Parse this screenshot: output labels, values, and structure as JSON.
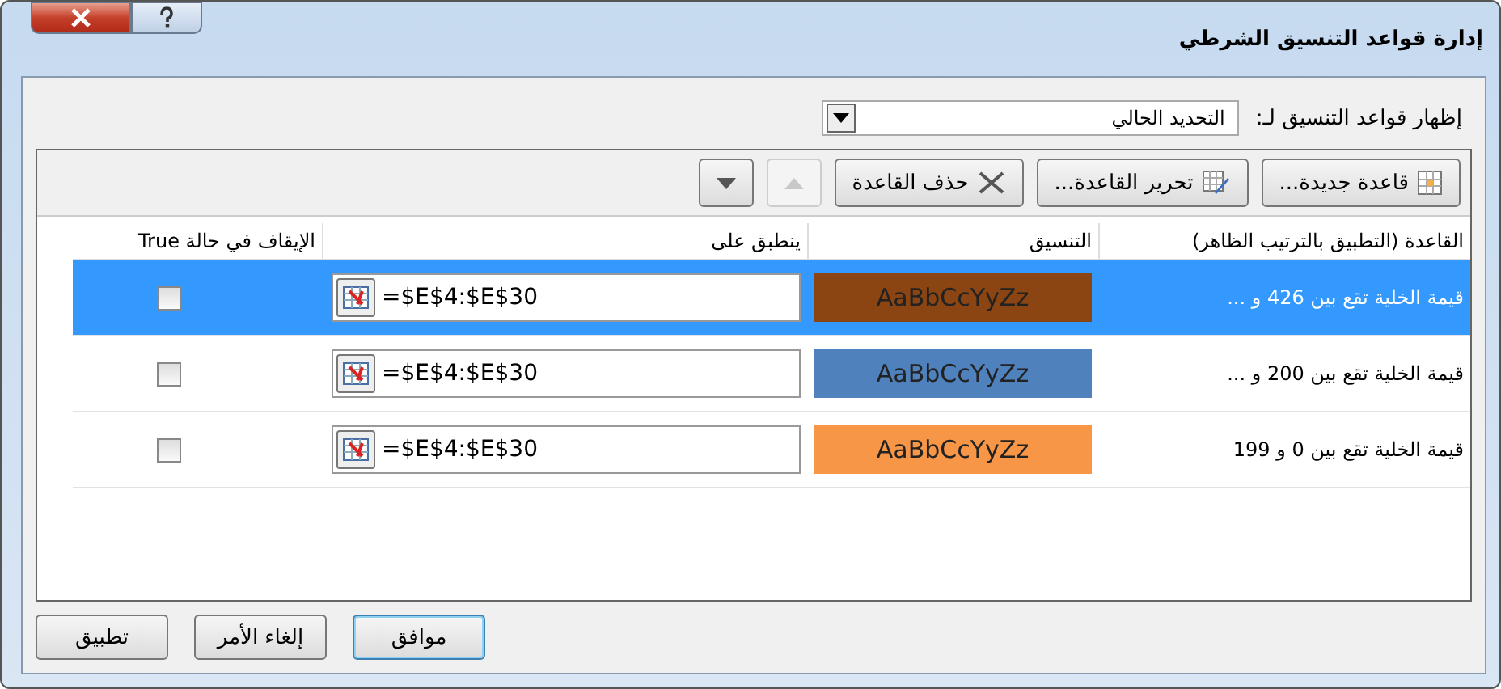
{
  "window": {
    "title": "إدارة قواعد التنسيق الشرطي"
  },
  "show_rules": {
    "label": "إظهار قواعد التنسيق لـ:",
    "value": "التحديد الحالي"
  },
  "toolbar": [
    {
      "kind": "new",
      "label": "قاعدة جديدة...",
      "disabled": false
    },
    {
      "kind": "edit",
      "label": "تحرير القاعدة...",
      "disabled": false
    },
    {
      "kind": "delete",
      "label": "حذف القاعدة",
      "disabled": false
    },
    {
      "kind": "up",
      "disabled": true
    },
    {
      "kind": "down",
      "disabled": false
    }
  ],
  "table": {
    "columns": [
      "القاعدة (التطبيق بالترتيب الظاهر)",
      "التنسيق",
      "ينطبق على",
      "الإيقاف في حالة True"
    ],
    "rows": [
      {
        "rule": "قيمة الخلية تقع بين 426 و ...",
        "preview": "AaBbCcYyZz",
        "color": "#8b4513",
        "applies_to": "=$E$4:$E$30",
        "stop_if_true": false,
        "selected": true
      },
      {
        "rule": "قيمة الخلية تقع بين 200 و ...",
        "preview": "AaBbCcYyZz",
        "color": "#4f81bd",
        "applies_to": "=$E$4:$E$30",
        "stop_if_true": false,
        "selected": false
      },
      {
        "rule": "قيمة الخلية تقع بين 0 و 199",
        "preview": "AaBbCcYyZz",
        "color": "#f79646",
        "applies_to": "=$E$4:$E$30",
        "stop_if_true": false,
        "selected": false
      }
    ]
  },
  "buttons": [
    {
      "kind": "ok",
      "label": "موافق"
    },
    {
      "kind": "cancel",
      "label": "إلغاء الأمر"
    },
    {
      "kind": "apply",
      "label": "تطبيق"
    }
  ]
}
